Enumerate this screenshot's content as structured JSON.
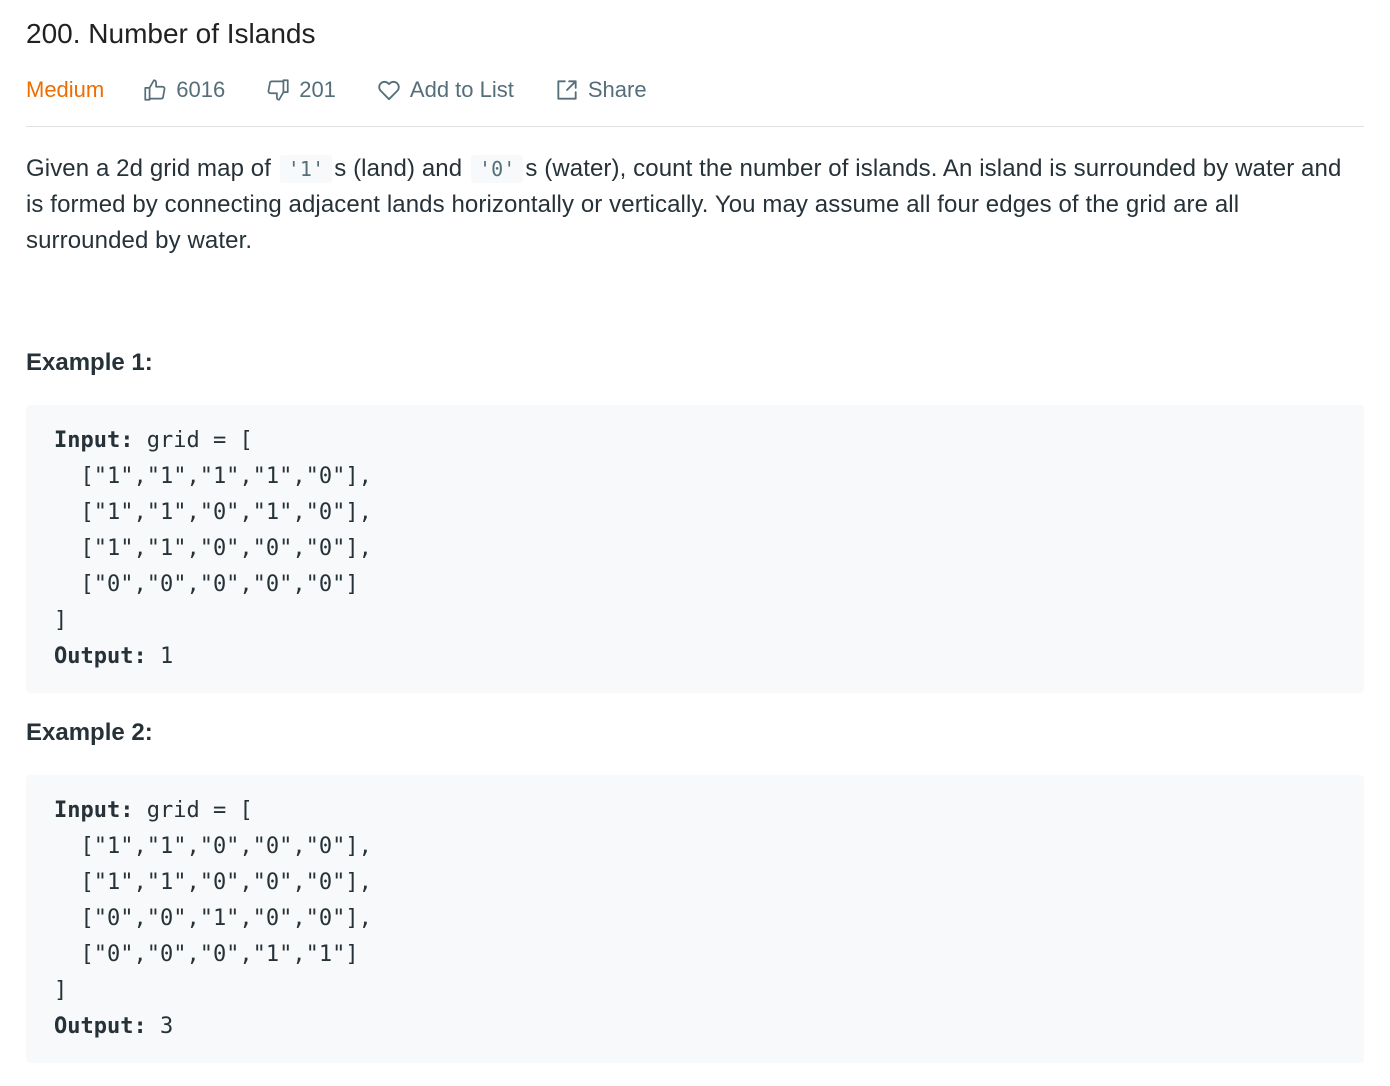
{
  "problem": {
    "title": "200. Number of Islands",
    "difficulty": "Medium",
    "likes": "6016",
    "dislikes": "201",
    "add_to_list_label": "Add to List",
    "share_label": "Share"
  },
  "description": {
    "part1": "Given a 2d grid map of ",
    "code1": "'1'",
    "part2": "s (land) and ",
    "code2": "'0'",
    "part3": "s (water), count the number of islands. An island is surrounded by water and is formed by connecting adjacent lands horizontally or vertically. You may assume all four edges of the grid are all surrounded by water."
  },
  "examples": [
    {
      "title": "Example 1:",
      "input_label": "Input:",
      "input_open": " grid = [",
      "grid_rows": [
        "  [\"1\",\"1\",\"1\",\"1\",\"0\"],",
        "  [\"1\",\"1\",\"0\",\"1\",\"0\"],",
        "  [\"1\",\"1\",\"0\",\"0\",\"0\"],",
        "  [\"0\",\"0\",\"0\",\"0\",\"0\"]"
      ],
      "input_close": "]",
      "output_label": "Output:",
      "output_value": " 1"
    },
    {
      "title": "Example 2:",
      "input_label": "Input:",
      "input_open": " grid = [",
      "grid_rows": [
        "  [\"1\",\"1\",\"0\",\"0\",\"0\"],",
        "  [\"1\",\"1\",\"0\",\"0\",\"0\"],",
        "  [\"0\",\"0\",\"1\",\"0\",\"0\"],",
        "  [\"0\",\"0\",\"0\",\"1\",\"1\"]"
      ],
      "input_close": "]",
      "output_label": "Output:",
      "output_value": " 3"
    }
  ],
  "colors": {
    "difficulty_medium": "#ef6c00",
    "meta_text": "#546e7a",
    "code_background": "#f7f9fa"
  },
  "icons": {
    "like": "thumbs-up-icon",
    "dislike": "thumbs-down-icon",
    "add_to_list": "heart-icon",
    "share": "share-icon"
  }
}
